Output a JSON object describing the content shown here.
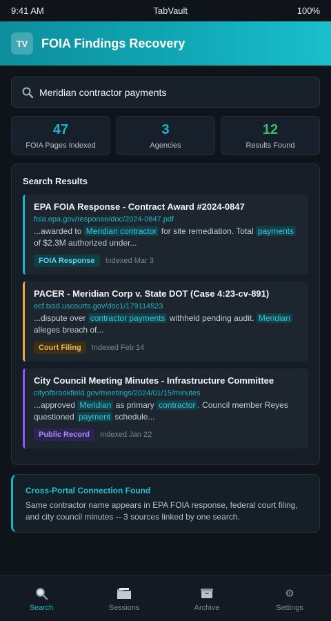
{
  "status_bar": {
    "time": "9:41 AM",
    "app_name": "TabVault",
    "battery": "100%"
  },
  "header": {
    "logo_text": "TV",
    "title": "FOIA Findings Recovery"
  },
  "search": {
    "value": "Meridian contractor payments"
  },
  "stats": [
    {
      "value": "47",
      "label": "FOIA Pages Indexed",
      "color": "#19b5c5"
    },
    {
      "value": "3",
      "label": "Agencies",
      "color": "#19b5c5"
    },
    {
      "value": "12",
      "label": "Results Found",
      "color": "#3fb86a"
    }
  ],
  "results": {
    "heading": "Search Results",
    "items": [
      {
        "title": "EPA FOIA Response - Contract Award #2024-0847",
        "url": "foia.epa.gov/response/doc/2024-0847.pdf",
        "snippet": [
          "...awarded to ",
          "Meridian contractor",
          " for site remediation. Total ",
          "payments",
          " of $2.3M authorized under..."
        ],
        "tag": "FOIA Response",
        "indexed": "Indexed Mar 3",
        "accent": "#14b8c8"
      },
      {
        "title": "PACER - Meridian Corp v. State DOT (Case 4:23-cv-891)",
        "url": "ecf.txsd.uscourts.gov/doc1/179114523",
        "snippet": [
          "...dispute over ",
          "contractor payments",
          " withheld pending audit. ",
          "Meridian",
          " alleges breach of..."
        ],
        "tag": "Court Filing",
        "indexed": "Indexed Feb 14",
        "accent": "#e8a93f"
      },
      {
        "title": "City Council Meeting Minutes - Infrastructure Committee",
        "url": "cityofbrookfield.gov/meetings/2024/01/15/minutes",
        "snippet": [
          "...approved ",
          "Meridian",
          " as primary ",
          "contractor",
          ". Council member Reyes questioned ",
          "payment",
          " schedule..."
        ],
        "tag": "Public Record",
        "indexed": "Indexed Jan 22",
        "accent": "#8a5cf6"
      }
    ]
  },
  "connection": {
    "title": "Cross-Portal Connection Found",
    "text": "Same contractor name appears in EPA FOIA response, federal court filing, and city council minutes -- 3 sources linked by one search."
  },
  "nav": [
    {
      "label": "Search",
      "icon": "search-icon"
    },
    {
      "label": "Sessions",
      "icon": "folder-icon"
    },
    {
      "label": "Archive",
      "icon": "archive-icon"
    },
    {
      "label": "Settings",
      "icon": "gear-icon"
    }
  ]
}
